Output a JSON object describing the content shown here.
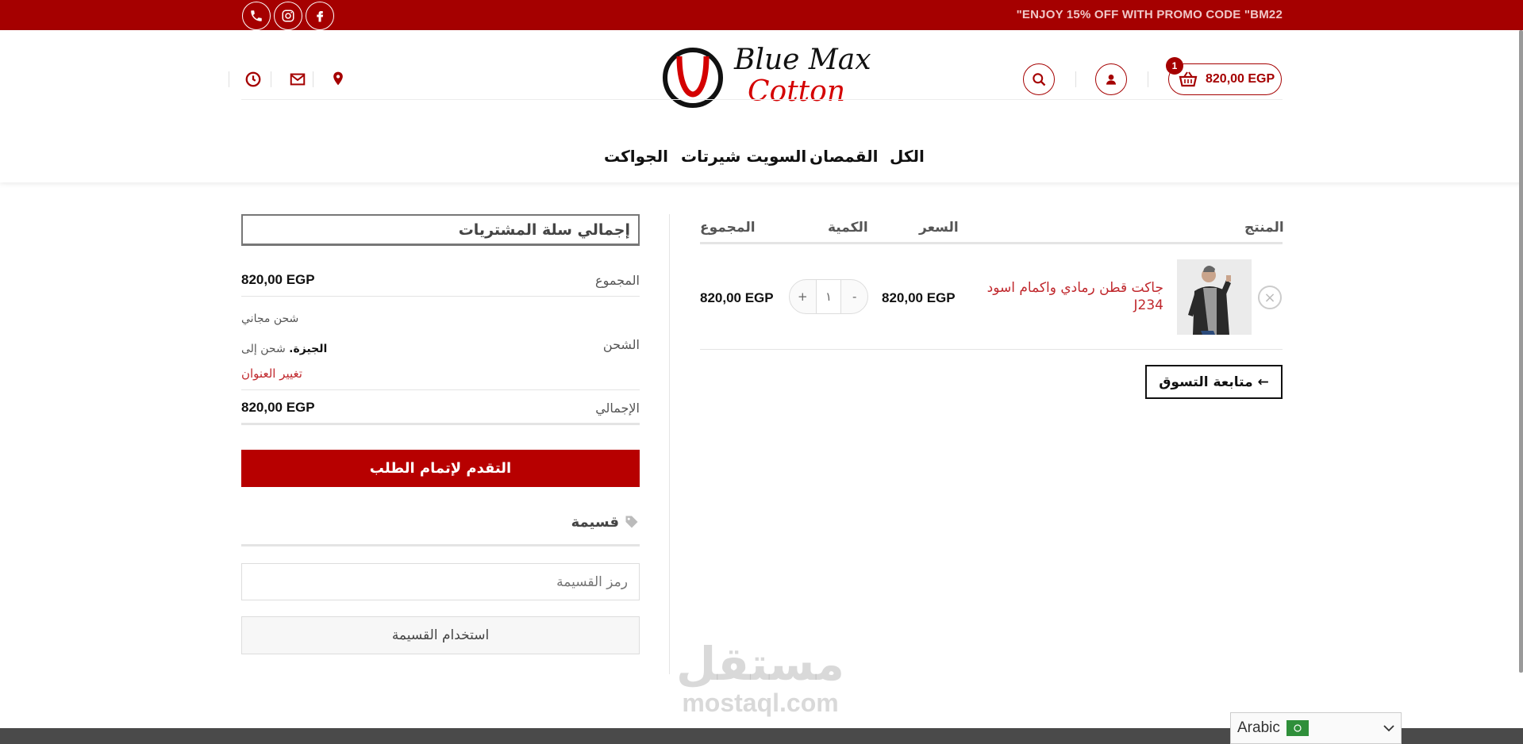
{
  "colors": {
    "brand": "#a50000",
    "accent_link": "#c0282d",
    "checkout": "#b70000"
  },
  "topbar": {
    "promo": "\"ENJOY 15% OFF WITH PROMO CODE \"BM22",
    "social_icons": [
      "phone-icon",
      "instagram-icon",
      "facebook-icon"
    ]
  },
  "header": {
    "logo": {
      "line1": "Blue Max",
      "line2": "Cotton"
    },
    "cart": {
      "badge": "1",
      "amount": "820,00 EGP"
    },
    "contact_icons": [
      "clock-icon",
      "mail-icon",
      "location-icon"
    ]
  },
  "nav": [
    "الكل",
    "القمصان",
    "السويت شيرتات",
    "الجواكت"
  ],
  "cart_table": {
    "headers": {
      "product": "المنتج",
      "price": "السعر",
      "quantity": "الكمية",
      "subtotal": "المجموع"
    },
    "rows": [
      {
        "name": "جاكت قطن رمادي واكمام اسود J234",
        "price": "820,00 EGP",
        "quantity": "١",
        "subtotal": "820,00 EGP",
        "qty_minus": "-",
        "qty_plus": "+"
      }
    ],
    "continue_label": "← متابعة التسوق"
  },
  "totals": {
    "title": "إجمالي سلة المشتريات",
    "subtotal_label": "المجموع",
    "subtotal_value": "820,00 EGP",
    "shipping_label": "الشحن",
    "shipping_method": "شحن مجاني",
    "shipping_to_prefix": "شحن إلى",
    "shipping_to_place": "الجيزة.",
    "change_address": "تغيير العنوان",
    "total_label": "الإجمالي",
    "total_value": "820,00 EGP",
    "checkout_label": "التقدم لإتمام الطلب"
  },
  "coupon": {
    "heading": "قسيمة",
    "placeholder": "رمز القسيمة",
    "apply_label": "استخدام القسيمة"
  },
  "watermark": {
    "arabic": "مستقل",
    "latin": "mostaql.com"
  },
  "language": {
    "selected": "Arabic"
  }
}
